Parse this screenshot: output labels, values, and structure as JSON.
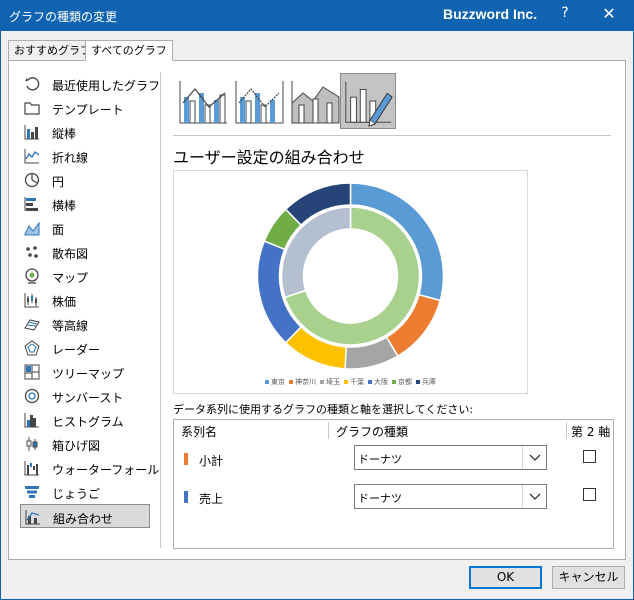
{
  "window": {
    "title": "グラフの種類の変更",
    "brand": "Buzzword Inc.",
    "help_glyph": "?",
    "close_glyph": "✕"
  },
  "tabs": [
    {
      "label": "おすすめグラフ"
    },
    {
      "label": "すべてのグラフ"
    }
  ],
  "sidebar": {
    "items": [
      {
        "label": "最近使用したグラフ",
        "icon": "recent-icon"
      },
      {
        "label": "テンプレート",
        "icon": "folder-icon"
      },
      {
        "label": "縦棒",
        "icon": "column-chart-icon"
      },
      {
        "label": "折れ線",
        "icon": "line-chart-icon"
      },
      {
        "label": "円",
        "icon": "pie-chart-icon"
      },
      {
        "label": "横棒",
        "icon": "bar-chart-icon"
      },
      {
        "label": "面",
        "icon": "area-chart-icon"
      },
      {
        "label": "散布図",
        "icon": "scatter-chart-icon"
      },
      {
        "label": "マップ",
        "icon": "map-chart-icon"
      },
      {
        "label": "株価",
        "icon": "stock-chart-icon"
      },
      {
        "label": "等高線",
        "icon": "surface-chart-icon"
      },
      {
        "label": "レーダー",
        "icon": "radar-chart-icon"
      },
      {
        "label": "ツリーマップ",
        "icon": "treemap-icon"
      },
      {
        "label": "サンバースト",
        "icon": "sunburst-icon"
      },
      {
        "label": "ヒストグラム",
        "icon": "histogram-icon"
      },
      {
        "label": "箱ひげ図",
        "icon": "box-whisker-icon"
      },
      {
        "label": "ウォーターフォール",
        "icon": "waterfall-icon"
      },
      {
        "label": "じょうご",
        "icon": "funnel-icon"
      },
      {
        "label": "組み合わせ",
        "icon": "combo-chart-icon"
      }
    ],
    "selected_index": 18
  },
  "combo_types": [
    {
      "icon": "clustered-column-line-icon"
    },
    {
      "icon": "clustered-column-line-secondary-axis-icon"
    },
    {
      "icon": "stacked-area-clustered-column-icon"
    },
    {
      "icon": "custom-combination-icon"
    }
  ],
  "combo_selected_index": 3,
  "heading": "ユーザー設定の組み合わせ",
  "chart_data": {
    "type": "pie",
    "categories": [
      "東京",
      "神奈川",
      "埼玉",
      "千葉",
      "大阪",
      "京都",
      "兵庫"
    ],
    "colors": [
      "#5b9bd5",
      "#ed7d31",
      "#a5a5a5",
      "#ffc000",
      "#4472c4",
      "#70ad47",
      "#264478"
    ],
    "series": [
      {
        "name": "小計",
        "values": [
          31,
          13,
          10,
          12,
          20,
          7,
          13
        ]
      },
      {
        "name": "売上",
        "values": [
          70,
          0,
          0,
          0,
          30,
          0,
          0
        ]
      }
    ],
    "series_colors": {
      "売上": [
        "#a9d18e",
        "#b4c0d0"
      ]
    },
    "legend_position": "bottom"
  },
  "instruction": "データ系列に使用するグラフの種類と軸を選択してください:",
  "table": {
    "headers": {
      "name": "系列名",
      "type": "グラフの種類",
      "axis": "第 2 軸"
    },
    "rows": [
      {
        "name": "小計",
        "color": "#ed7d31",
        "chart_type": "ドーナツ",
        "secondary": false
      },
      {
        "name": "売上",
        "color": "#4472c4",
        "chart_type": "ドーナツ",
        "secondary": false
      }
    ]
  },
  "buttons": {
    "ok": "OK",
    "cancel": "キャンセル"
  }
}
